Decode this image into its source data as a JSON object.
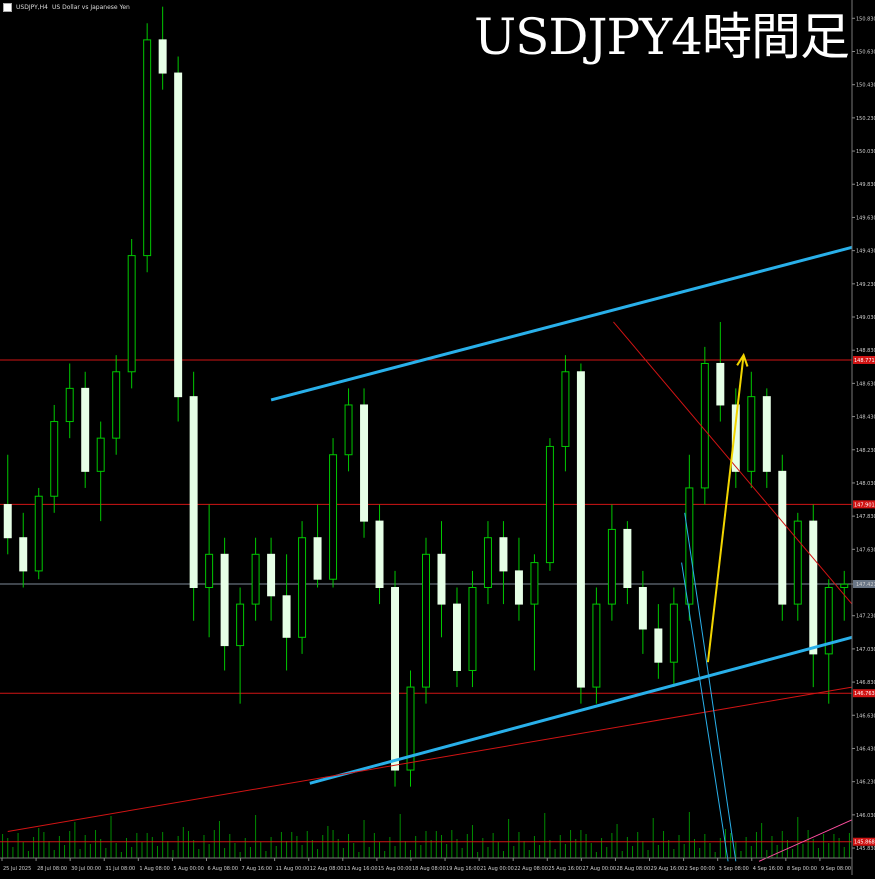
{
  "header": {
    "symbol": "USDJPY,H4",
    "description": "US Dollar vs Japanese Yen"
  },
  "overlay_title": "USDJPY4時間足",
  "colors": {
    "background": "#000000",
    "candle_up": "#00c800",
    "candle_down": "#e6ffe6",
    "wick": "#00c800",
    "channel": "#29b0ea",
    "resistance": "#d11414",
    "forecast": "#f2d500",
    "pink_band": "#ff4fa0",
    "grid_text": "#cfcfcf"
  },
  "chart_data": {
    "type": "candlestick",
    "title": "USDJPY4時間足",
    "x": [
      "25 Jul 2025",
      "28 Jul 08:00",
      "30 Jul 00:00",
      "31 Jul 08:00",
      "1 Aug 08:00",
      "5 Aug 00:00",
      "6 Aug 08:00",
      "7 Aug 16:00",
      "11 Aug 00:00",
      "12 Aug 08:00",
      "13 Aug 16:00",
      "15 Aug 00:00",
      "18 Aug 08:00",
      "19 Aug 16:00",
      "21 Aug 00:00",
      "22 Aug 08:00",
      "25 Aug 16:00",
      "27 Aug 00:00",
      "28 Aug 08:00",
      "29 Aug 16:00",
      "2 Sep 00:00",
      "3 Sep 08:00",
      "4 Sep 16:00",
      "8 Sep 00:00",
      "9 Sep 08:00"
    ],
    "y_ticks": [
      "150.830",
      "150.630",
      "150.430",
      "150.230",
      "150.030",
      "149.830",
      "149.630",
      "149.430",
      "149.230",
      "149.030",
      "148.830",
      "148.630",
      "148.430",
      "148.230",
      "148.030",
      "147.830",
      "147.630",
      "147.421",
      "147.230",
      "147.030",
      "146.830",
      "146.630",
      "146.430",
      "146.230",
      "146.030",
      "145.830"
    ],
    "ylim": [
      145.77,
      150.88
    ],
    "current_price": 147.421,
    "horizontal_lines": [
      {
        "price": 148.771,
        "label": "148.771"
      },
      {
        "price": 147.901,
        "label": "147.901"
      },
      {
        "price": 146.763,
        "label": "146.763"
      },
      {
        "price": 145.868,
        "label": "145.868"
      }
    ],
    "ohlc": [
      [
        147.9,
        148.2,
        147.6,
        147.7
      ],
      [
        147.7,
        147.85,
        147.4,
        147.5
      ],
      [
        147.5,
        148.0,
        147.45,
        147.95
      ],
      [
        147.95,
        148.5,
        147.85,
        148.4
      ],
      [
        148.4,
        148.75,
        148.3,
        148.6
      ],
      [
        148.6,
        148.7,
        148.0,
        148.1
      ],
      [
        148.1,
        148.4,
        147.8,
        148.3
      ],
      [
        148.3,
        148.8,
        148.2,
        148.7
      ],
      [
        148.7,
        149.5,
        148.6,
        149.4
      ],
      [
        149.4,
        150.8,
        149.3,
        150.7
      ],
      [
        150.7,
        150.9,
        150.4,
        150.5
      ],
      [
        150.5,
        150.6,
        148.4,
        148.55
      ],
      [
        148.55,
        148.7,
        147.2,
        147.4
      ],
      [
        147.4,
        147.9,
        147.1,
        147.6
      ],
      [
        147.6,
        147.7,
        146.9,
        147.05
      ],
      [
        147.05,
        147.4,
        146.7,
        147.3
      ],
      [
        147.3,
        147.7,
        147.2,
        147.6
      ],
      [
        147.6,
        147.7,
        147.2,
        147.35
      ],
      [
        147.35,
        147.6,
        146.9,
        147.1
      ],
      [
        147.1,
        147.8,
        147.0,
        147.7
      ],
      [
        147.7,
        147.9,
        147.4,
        147.45
      ],
      [
        147.45,
        148.3,
        147.4,
        148.2
      ],
      [
        148.2,
        148.6,
        148.1,
        148.5
      ],
      [
        148.5,
        148.6,
        147.7,
        147.8
      ],
      [
        147.8,
        147.9,
        147.3,
        147.4
      ],
      [
        147.4,
        147.5,
        146.2,
        146.3
      ],
      [
        146.3,
        146.9,
        146.2,
        146.8
      ],
      [
        146.8,
        147.7,
        146.7,
        147.6
      ],
      [
        147.6,
        147.8,
        147.1,
        147.3
      ],
      [
        147.3,
        147.4,
        146.8,
        146.9
      ],
      [
        146.9,
        147.5,
        146.8,
        147.4
      ],
      [
        147.4,
        147.8,
        147.3,
        147.7
      ],
      [
        147.7,
        147.8,
        147.3,
        147.5
      ],
      [
        147.5,
        147.7,
        147.2,
        147.3
      ],
      [
        147.3,
        147.6,
        146.9,
        147.55
      ],
      [
        147.55,
        148.3,
        147.5,
        148.25
      ],
      [
        148.25,
        148.8,
        148.1,
        148.7
      ],
      [
        148.7,
        148.75,
        146.7,
        146.8
      ],
      [
        146.8,
        147.4,
        146.7,
        147.3
      ],
      [
        147.3,
        147.9,
        147.2,
        147.75
      ],
      [
        147.75,
        147.8,
        147.3,
        147.4
      ],
      [
        147.4,
        147.5,
        147.0,
        147.15
      ],
      [
        147.15,
        147.3,
        146.85,
        146.95
      ],
      [
        146.95,
        147.4,
        146.8,
        147.3
      ],
      [
        147.3,
        148.2,
        147.2,
        148.0
      ],
      [
        148.0,
        148.85,
        147.9,
        148.75
      ],
      [
        148.75,
        149.0,
        148.4,
        148.5
      ],
      [
        148.5,
        148.6,
        148.0,
        148.1
      ],
      [
        148.1,
        148.7,
        148.0,
        148.55
      ],
      [
        148.55,
        148.6,
        148.0,
        148.1
      ],
      [
        148.1,
        148.2,
        147.2,
        147.3
      ],
      [
        147.3,
        147.85,
        147.2,
        147.8
      ],
      [
        147.8,
        147.9,
        146.8,
        147.0
      ],
      [
        147.0,
        147.45,
        146.7,
        147.4
      ],
      [
        147.4,
        147.5,
        147.2,
        147.42
      ]
    ],
    "drawings": [
      {
        "name": "channel-upper",
        "color": "channel",
        "from": [
          17,
          148.53
        ],
        "to": [
          54.5,
          149.45
        ]
      },
      {
        "name": "channel-lower",
        "color": "channel",
        "from": [
          19.5,
          146.22
        ],
        "to": [
          54.5,
          147.1
        ]
      },
      {
        "name": "red-trendline-lower",
        "color": "resistance",
        "from": [
          0,
          145.93
        ],
        "to": [
          54.5,
          146.8
        ]
      },
      {
        "name": "red-trendline-falling",
        "color": "resistance",
        "from": [
          39.1,
          149.0
        ],
        "to": [
          54.5,
          147.3
        ]
      },
      {
        "name": "yellow-forecast-arrow",
        "color": "forecast",
        "from": [
          45.2,
          146.95
        ],
        "to": [
          47.5,
          148.8
        ]
      },
      {
        "name": "cyan-falling-line",
        "color": "channel",
        "from": [
          43.7,
          147.85
        ],
        "to": [
          47.0,
          145.75
        ]
      },
      {
        "name": "teal-falling-line",
        "color": "channel",
        "from": [
          43.5,
          147.55
        ],
        "to": [
          46.5,
          145.75
        ]
      },
      {
        "name": "pink-band",
        "color": "pink_band",
        "from": [
          48.5,
          145.75
        ],
        "to": [
          54.5,
          146.0
        ]
      }
    ]
  }
}
